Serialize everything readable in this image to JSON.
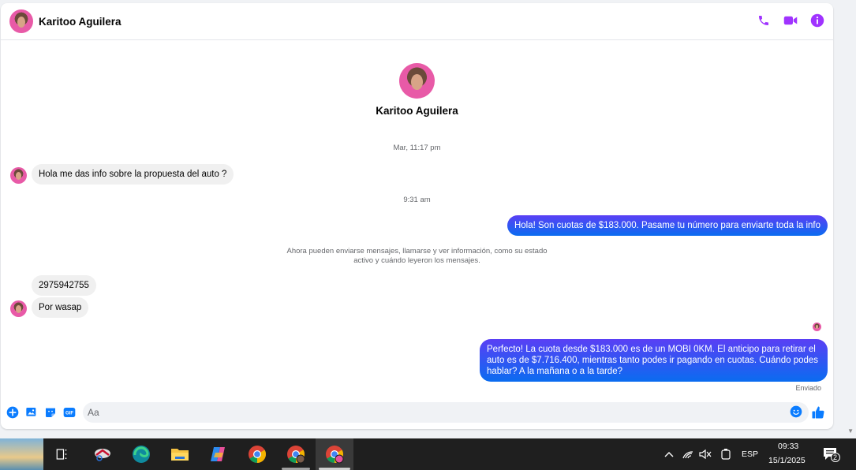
{
  "contact": {
    "name": "Karitoo Aguilera"
  },
  "header": {
    "icons": [
      "phone-icon",
      "video-camera-icon",
      "info-icon"
    ],
    "accent_color": "#a033ff"
  },
  "profile": {
    "name": "Karitoo Aguilera"
  },
  "timestamps": {
    "first": "Mar, 11:17 pm",
    "second": "9:31 am"
  },
  "messages": {
    "m1": "Hola me das info sobre la propuesta del auto ?",
    "m2": "Hola! Son cuotas de $183.000. Pasame tu número para enviarte toda la info",
    "notice": "Ahora pueden enviarse mensajes, llamarse y ver información, como su estado activo y cuándo leyeron los mensajes.",
    "m3": "2975942755",
    "m4": "Por wasap",
    "m5": "Perfecto! La cuota desde $183.000 es de un MOBI 0KM. El anticipo para retirar el auto es de $7.716.400, mientras tanto podes ir pagando en cuotas. Cuándo podes hablar? A la mañana o a la tarde?",
    "status": "Enviado"
  },
  "composer": {
    "placeholder": "Aa",
    "icons": [
      "add-circle-icon",
      "photo-icon",
      "sticker-icon",
      "gif-icon",
      "emoji-icon",
      "thumbs-up-icon"
    ]
  },
  "taskbar": {
    "apps": [
      "task-view-icon",
      "snipping-tool-icon",
      "edge-icon",
      "file-explorer-icon",
      "copilot-icon",
      "chrome-icon",
      "chrome-profile-icon",
      "chrome-profile-active-icon"
    ],
    "language": "ESP",
    "time": "09:33",
    "date": "15/1/2025",
    "notifications": "2"
  },
  "colors": {
    "outgoing_start": "#5a3ff5",
    "outgoing_end": "#0a6cf0",
    "incoming": "#f0f0f0",
    "icon_blue": "#0a7cff"
  }
}
